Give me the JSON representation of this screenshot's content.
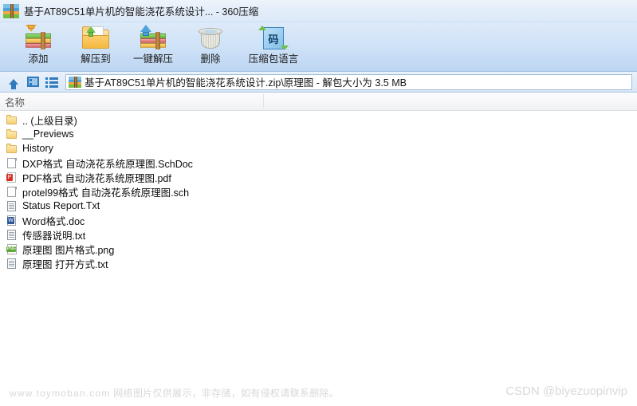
{
  "window": {
    "title": "基于AT89C51单片机的智能浇花系统设计... - 360压缩",
    "app_icon": "archive-icon"
  },
  "toolbar": {
    "buttons": [
      {
        "label": "添加",
        "icon": "add-to-archive-icon"
      },
      {
        "label": "解压到",
        "icon": "extract-to-folder-icon"
      },
      {
        "label": "一键解压",
        "icon": "one-click-extract-icon"
      },
      {
        "label": "删除",
        "icon": "delete-trash-icon"
      },
      {
        "label": "压缩包语言",
        "icon": "archive-language-icon"
      }
    ]
  },
  "addressbar": {
    "up_icon": "up-arrow-icon",
    "panel_icon": "preview-panel-icon",
    "list_icon": "list-view-icon",
    "path_icon": "archive-icon",
    "path": "基于AT89C51单片机的智能浇花系统设计.zip\\原理图 - 解包大小为 3.5 MB"
  },
  "columns": {
    "name": "名称"
  },
  "files": [
    {
      "name": ".. (上级目录)",
      "icon": "folder-icon",
      "type": "folder"
    },
    {
      "name": "__Previews",
      "icon": "folder-icon",
      "type": "folder"
    },
    {
      "name": "History",
      "icon": "folder-icon",
      "type": "folder"
    },
    {
      "name": "DXP格式 自动浇花系统原理图.SchDoc",
      "icon": "document-icon",
      "type": "doc"
    },
    {
      "name": "PDF格式 自动浇花系统原理图.pdf",
      "icon": "pdf-file-icon",
      "type": "pdf",
      "badge": "P"
    },
    {
      "name": "protel99格式 自动浇花系统原理图.sch",
      "icon": "document-icon",
      "type": "doc"
    },
    {
      "name": "Status Report.Txt",
      "icon": "text-file-icon",
      "type": "txt"
    },
    {
      "name": "Word格式.doc",
      "icon": "word-file-icon",
      "type": "word",
      "badge": "W"
    },
    {
      "name": "传感器说明.txt",
      "icon": "text-file-icon",
      "type": "txt"
    },
    {
      "name": "原理图  图片格式.png",
      "icon": "png-image-icon",
      "type": "png",
      "badge": "PNG"
    },
    {
      "name": "原理图 打开方式.txt",
      "icon": "text-file-icon",
      "type": "txt"
    }
  ],
  "watermarks": {
    "bottom_domain": "www.toymoban.com",
    "bottom_text": "网络图片仅供展示，非存储，如有侵权请联系删除。",
    "csdn": "CSDN @biyezuopinvip"
  },
  "colors": {
    "titlebar_top": "#eef4fb",
    "toolbar_top": "#ddeaf9",
    "toolbar_bottom": "#bcd6f2",
    "accent_blue": "#2f79bd",
    "folder_yellow": "#f6c460",
    "pdf_red": "#d93025",
    "word_blue": "#2b579a",
    "png_green": "#63a83b",
    "watermark_gray": "#d8d8d8"
  }
}
